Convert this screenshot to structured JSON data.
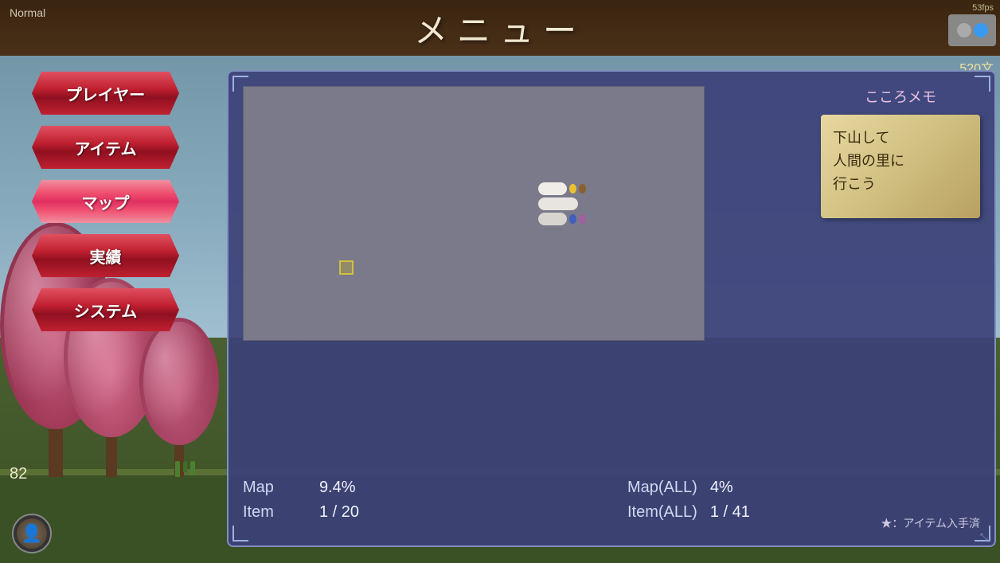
{
  "topbar": {
    "difficulty": "Normal",
    "title": "メニュー",
    "fps": "53fps",
    "currency": "520文"
  },
  "nav": {
    "player_label": "プレイヤー",
    "item_label": "アイテム",
    "map_label": "マップ",
    "achievement_label": "実績",
    "system_label": "システム",
    "active": "map"
  },
  "left_number": "82",
  "map_panel": {
    "kokoro_title": "こころメモ",
    "kokoro_text": "下山して\n人間の里に\n行こう",
    "star_note": "★：アイテム入手済",
    "stats": {
      "map_label": "Map",
      "map_value": "9.4%",
      "map_all_label": "Map(ALL)",
      "map_all_value": "4%",
      "item_label": "Item",
      "item_value": "1 / 20",
      "item_all_label": "Item(ALL)",
      "item_all_value": "1 / 41"
    }
  }
}
